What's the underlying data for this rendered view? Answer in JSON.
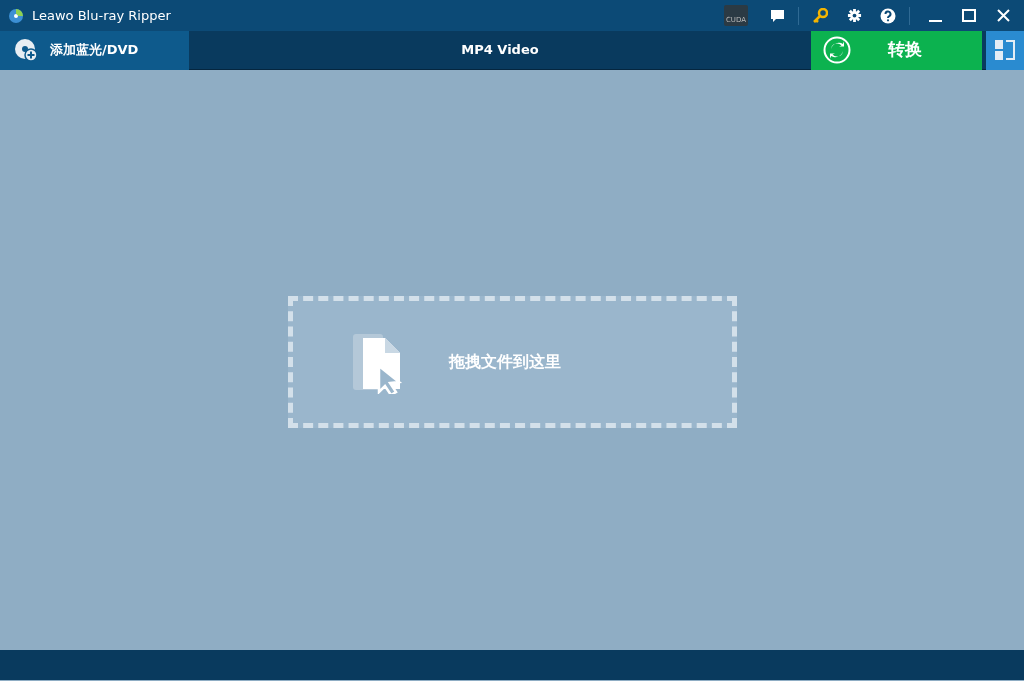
{
  "window": {
    "title": "Leawo Blu-ray Ripper"
  },
  "title_bar": {
    "cuda_label": "CUDA"
  },
  "toolbar": {
    "add_button": "添加蓝光/DVD",
    "profile": "MP4 Video",
    "convert_button": "转换"
  },
  "drop_zone": {
    "text": "拖拽文件到这里"
  }
}
